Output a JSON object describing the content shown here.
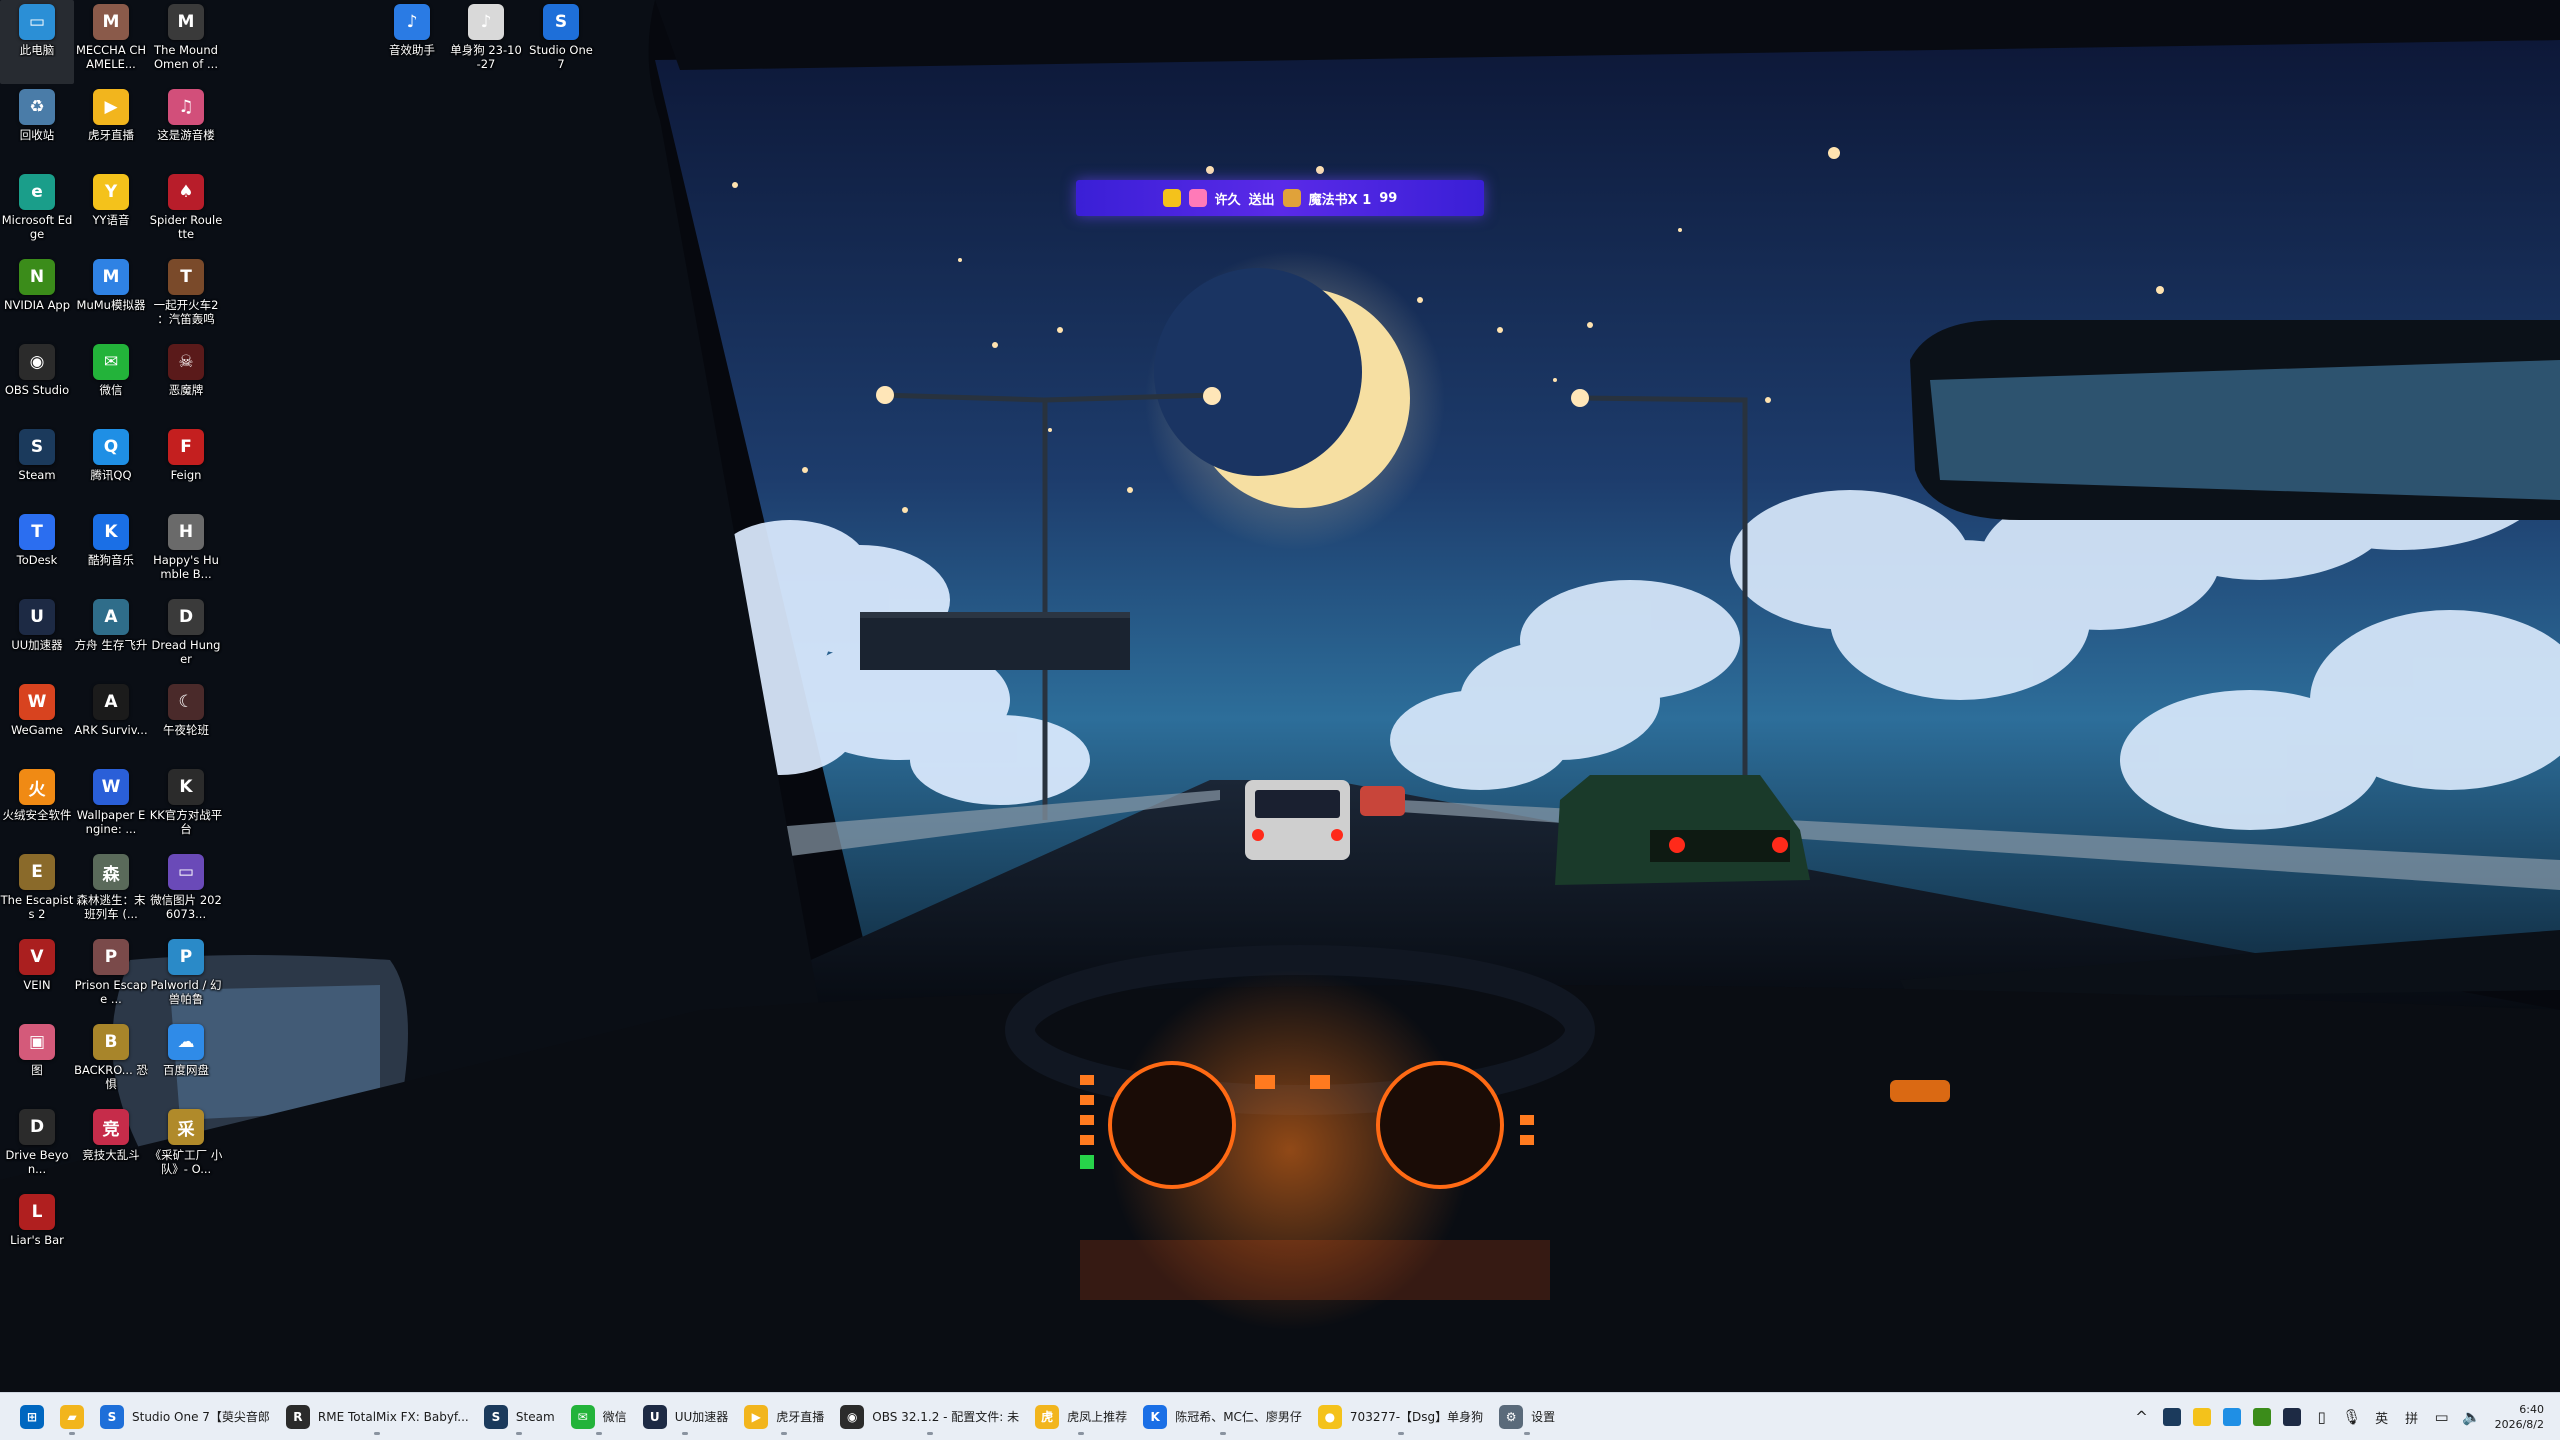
{
  "desktop": {
    "icons": [
      {
        "id": "this-pc",
        "label": "此电脑",
        "glyph": "▭",
        "color": "#2b8fd6"
      },
      {
        "id": "meccha",
        "label": "MECCHA CHAMELE...",
        "glyph": "M",
        "color": "#8a5a4a"
      },
      {
        "id": "mound",
        "label": "The Mound Omen of ...",
        "glyph": "M",
        "color": "#3a3a3a"
      },
      {
        "id": "yinxiao",
        "label": "音效助手",
        "glyph": "♪",
        "color": "#2a7be4"
      },
      {
        "id": "danshengou",
        "label": "单身狗 23-10-27",
        "glyph": "♪",
        "color": "#d9d9d9"
      },
      {
        "id": "studio-one",
        "label": "Studio One 7",
        "glyph": "S",
        "color": "#1e6fd9"
      },
      {
        "id": "recycle",
        "label": "回收站",
        "glyph": "♻",
        "color": "#4a7ca8"
      },
      {
        "id": "huya",
        "label": "虎牙直播",
        "glyph": "▶",
        "color": "#f2b51d"
      },
      {
        "id": "zheshi",
        "label": "这是游音楼",
        "glyph": "♫",
        "color": "#d24f7a"
      },
      {
        "id": "edge",
        "label": "Microsoft Edge",
        "glyph": "e",
        "color": "#1a9e8a"
      },
      {
        "id": "yy",
        "label": "YY语音",
        "glyph": "Y",
        "color": "#f4c21b"
      },
      {
        "id": "spider",
        "label": "Spider Roulette",
        "glyph": "♠",
        "color": "#b81d2a"
      },
      {
        "id": "nvidia",
        "label": "NVIDIA App",
        "glyph": "N",
        "color": "#3b8c1a"
      },
      {
        "id": "mumu",
        "label": "MuMu模拟器",
        "glyph": "M",
        "color": "#2f82e4"
      },
      {
        "id": "train",
        "label": "一起开火车2 ：汽笛轰鸣",
        "glyph": "T",
        "color": "#7a4a2a"
      },
      {
        "id": "obs",
        "label": "OBS Studio",
        "glyph": "◉",
        "color": "#2b2b2b"
      },
      {
        "id": "wechat",
        "label": "微信",
        "glyph": "✉",
        "color": "#23b33a"
      },
      {
        "id": "emo",
        "label": "恶魔牌",
        "glyph": "☠",
        "color": "#5a1a1a"
      },
      {
        "id": "steam",
        "label": "Steam",
        "glyph": "S",
        "color": "#1b3a5c"
      },
      {
        "id": "qq",
        "label": "腾讯QQ",
        "glyph": "Q",
        "color": "#1f8fe5"
      },
      {
        "id": "feign",
        "label": "Feign",
        "glyph": "F",
        "color": "#c41f1f"
      },
      {
        "id": "todesk",
        "label": "ToDesk",
        "glyph": "T",
        "color": "#2b6ef0"
      },
      {
        "id": "kugou",
        "label": "酷狗音乐",
        "glyph": "K",
        "color": "#1a6fe6"
      },
      {
        "id": "humble",
        "label": "Happy's Humble B...",
        "glyph": "H",
        "color": "#6a6a6a"
      },
      {
        "id": "uu",
        "label": "UU加速器",
        "glyph": "U",
        "color": "#1d2a44"
      },
      {
        "id": "fangzhou",
        "label": "方舟 生存飞升",
        "glyph": "A",
        "color": "#2f6d8a"
      },
      {
        "id": "dread",
        "label": "Dread Hunger",
        "glyph": "D",
        "color": "#3a3a3a"
      },
      {
        "id": "wegame",
        "label": "WeGame",
        "glyph": "W",
        "color": "#d8431f"
      },
      {
        "id": "ark",
        "label": "ARK Surviv...",
        "glyph": "A",
        "color": "#1b1b1b"
      },
      {
        "id": "wuye",
        "label": "午夜轮班",
        "glyph": "☾",
        "color": "#4a2a2a"
      },
      {
        "id": "huorong",
        "label": "火绒安全软件",
        "glyph": "火",
        "color": "#f08a14"
      },
      {
        "id": "wallpaper",
        "label": "Wallpaper Engine: ...",
        "glyph": "W",
        "color": "#2a5fd8"
      },
      {
        "id": "kk",
        "label": "KK官方对战平台",
        "glyph": "K",
        "color": "#2b2b2b"
      },
      {
        "id": "escapists",
        "label": "The Escapists 2",
        "glyph": "E",
        "color": "#8a6a2a"
      },
      {
        "id": "senlin",
        "label": "森林逃生：末班列车 (...",
        "glyph": "森",
        "color": "#5a6a5a"
      },
      {
        "id": "wximg",
        "label": "微信图片 2026073...",
        "glyph": "▭",
        "color": "#6a4ab8"
      },
      {
        "id": "vein",
        "label": "VEIN",
        "glyph": "V",
        "color": "#aa1f1f"
      },
      {
        "id": "prison",
        "label": "Prison Escape ...",
        "glyph": "P",
        "color": "#7a4a4a"
      },
      {
        "id": "palworld",
        "label": "Palworld / 幻兽帕鲁",
        "glyph": "P",
        "color": "#2a8ac8"
      },
      {
        "id": "tu",
        "label": "图",
        "glyph": "▣",
        "color": "#d45a7a"
      },
      {
        "id": "backrooms",
        "label": "BACKRO... 恐惧",
        "glyph": "B",
        "color": "#a8852a"
      },
      {
        "id": "baidu",
        "label": "百度网盘",
        "glyph": "☁",
        "color": "#2f8be8"
      },
      {
        "id": "drive",
        "label": "Drive Beyon...",
        "glyph": "D",
        "color": "#2b2b2b"
      },
      {
        "id": "jingji",
        "label": "竞技大乱斗",
        "glyph": "竞",
        "color": "#c62c4a"
      },
      {
        "id": "kuangshan",
        "label": "《采矿工厂 小队》- O...",
        "glyph": "采",
        "color": "#b08a2a"
      },
      {
        "id": "liars",
        "label": "Liar's Bar",
        "glyph": "L",
        "color": "#b01f1f"
      }
    ]
  },
  "banner": {
    "text_1": "许久",
    "text_2": "送出",
    "text_3": "魔法书X 1",
    "text_4": "99"
  },
  "taskbar": {
    "items": [
      {
        "id": "start",
        "label": "",
        "glyph": "⊞",
        "color": "#0067c0",
        "state": ""
      },
      {
        "id": "explorer",
        "label": "",
        "glyph": "▰",
        "color": "#f2b51d",
        "state": "running"
      },
      {
        "id": "studio-one",
        "label": "Studio One 7【萸尖音郎",
        "glyph": "S",
        "color": "#1e6fd9",
        "state": "active"
      },
      {
        "id": "rme",
        "label": "RME TotalMix FX: Babyf...",
        "glyph": "R",
        "color": "#2b2b2b",
        "state": "running"
      },
      {
        "id": "steam",
        "label": "Steam",
        "glyph": "S",
        "color": "#1b3a5c",
        "state": "running"
      },
      {
        "id": "wechat",
        "label": "微信",
        "glyph": "✉",
        "color": "#23b33a",
        "state": "running"
      },
      {
        "id": "uu",
        "label": "UU加速器",
        "glyph": "U",
        "color": "#1d2a44",
        "state": "running"
      },
      {
        "id": "huya",
        "label": "虎牙直播",
        "glyph": "▶",
        "color": "#f2b51d",
        "state": "running"
      },
      {
        "id": "obs",
        "label": "OBS 32.1.2 - 配置文件: 未",
        "glyph": "◉",
        "color": "#2b2b2b",
        "state": "running"
      },
      {
        "id": "huya-rec",
        "label": "虎凤上推荐",
        "glyph": "虎",
        "color": "#f2b51d",
        "state": "running"
      },
      {
        "id": "kugou",
        "label": "陈冠希、MC仁、廖男仔",
        "glyph": "K",
        "color": "#1a6fe6",
        "state": "running"
      },
      {
        "id": "live",
        "label": "703277-【Dsg】单身狗",
        "glyph": "●",
        "color": "#f4c21b",
        "state": "running"
      },
      {
        "id": "settings",
        "label": "设置",
        "glyph": "⚙",
        "color": "#5a6a7a",
        "state": "running"
      }
    ]
  },
  "tray": {
    "chevron": "^",
    "ime_lang": "英",
    "ime_mode": "拼",
    "time": "6:40",
    "date": "2026/8/2"
  }
}
